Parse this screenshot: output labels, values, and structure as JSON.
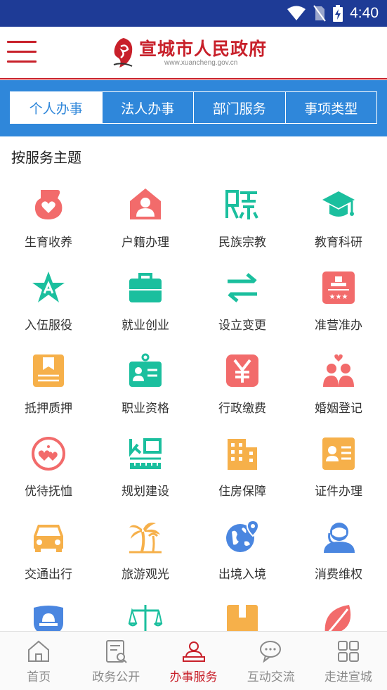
{
  "status_bar": {
    "time": "4:40",
    "icons": [
      "wifi-icon",
      "no-sim-icon",
      "battery-charging-icon"
    ]
  },
  "header": {
    "title": "宣城市人民政府",
    "url": "www.xuancheng.gov.cn",
    "menu_icon": "hamburger-menu-icon"
  },
  "tabs": [
    {
      "label": "个人办事",
      "active": true
    },
    {
      "label": "法人办事",
      "active": false
    },
    {
      "label": "部门服务",
      "active": false
    },
    {
      "label": "事项类型",
      "active": false
    }
  ],
  "section": {
    "title": "按服务主题"
  },
  "services": [
    {
      "label": "生育收养",
      "icon": "pregnancy-heart-icon"
    },
    {
      "label": "户籍办理",
      "icon": "house-person-icon"
    },
    {
      "label": "民族宗教",
      "icon": "ethnic-character-icon"
    },
    {
      "label": "教育科研",
      "icon": "graduation-cap-icon"
    },
    {
      "label": "入伍服役",
      "icon": "military-star-icon"
    },
    {
      "label": "就业创业",
      "icon": "briefcase-icon"
    },
    {
      "label": "设立变更",
      "icon": "swap-arrows-icon"
    },
    {
      "label": "准营准办",
      "icon": "license-certificate-icon"
    },
    {
      "label": "抵押质押",
      "icon": "pledge-book-icon"
    },
    {
      "label": "职业资格",
      "icon": "id-badge-icon"
    },
    {
      "label": "行政缴费",
      "icon": "yuan-payment-icon"
    },
    {
      "label": "婚姻登记",
      "icon": "couple-heart-icon"
    },
    {
      "label": "优待抚恤",
      "icon": "care-hearts-icon"
    },
    {
      "label": "规划建设",
      "icon": "city-planning-icon"
    },
    {
      "label": "住房保障",
      "icon": "apartment-building-icon"
    },
    {
      "label": "证件办理",
      "icon": "id-card-icon"
    },
    {
      "label": "交通出行",
      "icon": "car-icon"
    },
    {
      "label": "旅游观光",
      "icon": "palm-tree-icon"
    },
    {
      "label": "出境入境",
      "icon": "globe-pin-icon"
    },
    {
      "label": "消费维权",
      "icon": "customer-service-icon"
    },
    {
      "label": "",
      "icon": "police-light-icon"
    },
    {
      "label": "",
      "icon": "justice-scale-icon"
    },
    {
      "label": "",
      "icon": "box-package-icon"
    },
    {
      "label": "",
      "icon": "leaf-icon"
    }
  ],
  "bottom_nav": [
    {
      "label": "首页",
      "icon": "home-icon",
      "active": false
    },
    {
      "label": "政务公开",
      "icon": "document-search-icon",
      "active": false
    },
    {
      "label": "办事服务",
      "icon": "service-person-icon",
      "active": true
    },
    {
      "label": "互动交流",
      "icon": "chat-bubbles-icon",
      "active": false
    },
    {
      "label": "走进宣城",
      "icon": "grid-apps-icon",
      "active": false
    }
  ],
  "colors": {
    "status_bar": "#1e3b96",
    "brand_red": "#c8202a",
    "tab_blue": "#2f87da",
    "icon_coral": "#f26b6b",
    "icon_teal": "#1bbf9e",
    "icon_orange": "#f6b04a",
    "icon_blue": "#4a86e0",
    "nav_gray": "#8a8a8a"
  }
}
